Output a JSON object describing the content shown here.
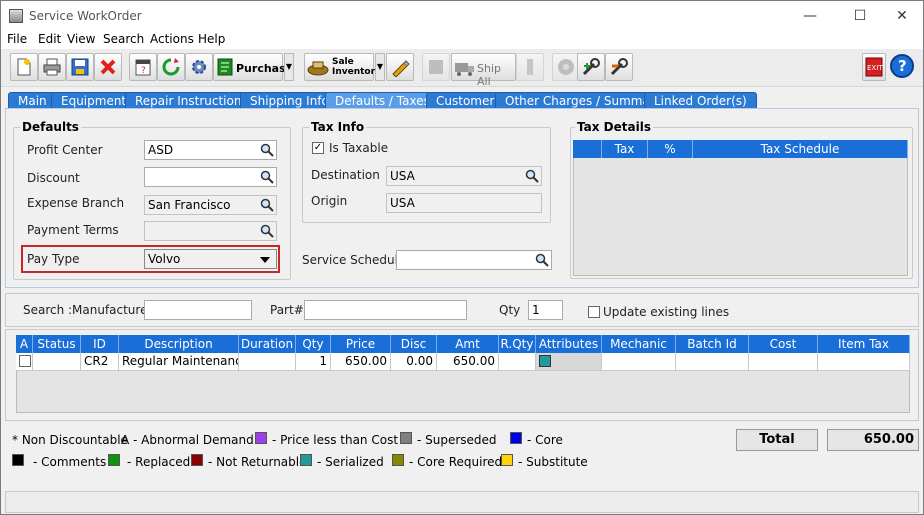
{
  "window": {
    "title": "Service WorkOrder"
  },
  "menu": [
    "File",
    "Edit",
    "View",
    "Search",
    "Actions",
    "Help"
  ],
  "toolbar": {
    "purchase": "Purchase",
    "sale_inventory_1": "Sale",
    "sale_inventory_2": "Inventory",
    "ship_all": "Ship All"
  },
  "tabs": [
    "Main",
    "Equipment",
    "Repair Instructions",
    "Shipping Info",
    "Defaults / Taxes",
    "Customer",
    "Other Charges / Summary",
    "Linked Order(s)"
  ],
  "defaults": {
    "title": "Defaults",
    "profit_center_label": "Profit Center",
    "profit_center_value": "ASD",
    "discount_label": "Discount",
    "discount_value": "",
    "expense_branch_label": "Expense Branch",
    "expense_branch_value": "San Francisco",
    "payment_terms_label": "Payment Terms",
    "payment_terms_value": "",
    "pay_type_label": "Pay Type",
    "pay_type_value": "Volvo"
  },
  "taxinfo": {
    "title": "Tax Info",
    "is_taxable_label": "Is Taxable",
    "is_taxable_checked": "✓",
    "destination_label": "Destination",
    "destination_value": "USA",
    "origin_label": "Origin",
    "origin_value": "USA"
  },
  "service_schedule": {
    "label": "Service Schedule",
    "value": ""
  },
  "taxdetails": {
    "title": "Tax Details",
    "columns": [
      "Tax",
      "%",
      "Tax Schedule"
    ]
  },
  "search": {
    "label": "Search :",
    "manufacturer_label": "Manufacturer",
    "manufacturer_value": "",
    "part_label": "Part#",
    "part_value": "",
    "qty_label": "Qty",
    "qty_value": "1",
    "update_label": "Update existing lines"
  },
  "grid": {
    "columns": [
      "A",
      "Status",
      "ID",
      "Description",
      "Duration",
      "Qty",
      "Price",
      "Disc",
      "Amt",
      "R.Qty",
      "Attributes",
      "Mechanic",
      "Batch Id",
      "Cost",
      "Item Tax Group"
    ],
    "row": {
      "status": "",
      "id": "CR2",
      "description": "Regular Maintenance",
      "duration": "",
      "qty": "1",
      "price": "650.00",
      "disc": "0.00",
      "amt": "650.00",
      "rqty": "",
      "mechanic": "",
      "batch": "",
      "cost": "",
      "itg": ""
    }
  },
  "legend": {
    "non_disc": "* Non Discountable",
    "abnormal": "A - Abnormal Demand",
    "items": [
      {
        "label": "- Price less than Cost",
        "color": "#9b3fe6"
      },
      {
        "label": "- Superseded",
        "color": "#808080"
      },
      {
        "label": "- Core",
        "color": "#0000ee"
      },
      {
        "label": "- Comments",
        "color": "#000000"
      },
      {
        "label": "- Replaced",
        "color": "#119311"
      },
      {
        "label": "- Not Returnable",
        "color": "#8b0000"
      },
      {
        "label": "- Serialized",
        "color": "#229a9a"
      },
      {
        "label": "- Core Required",
        "color": "#888800"
      },
      {
        "label": "- Substitute",
        "color": "#ffd400"
      }
    ]
  },
  "total": {
    "label": "Total",
    "value": "650.00"
  },
  "colors": {
    "tab_blue": "#2b7ad4",
    "header_blue": "#1a6ed8",
    "highlight_red": "#c62828"
  }
}
